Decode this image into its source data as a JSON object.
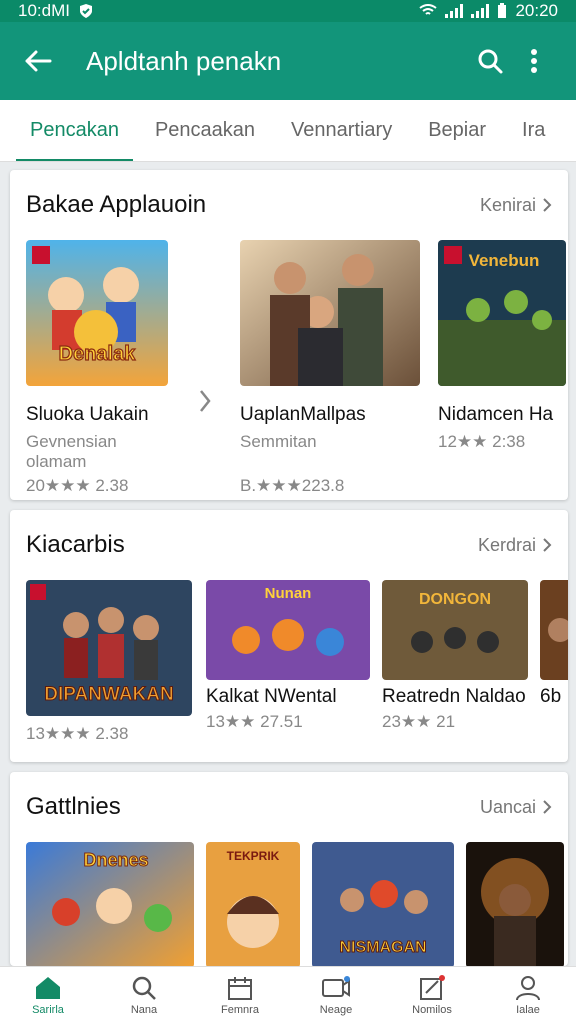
{
  "status": {
    "time": "10:dMI",
    "clock": "20:20"
  },
  "appbar": {
    "title": "Apldtanh penakn"
  },
  "tabs": [
    {
      "label": "Pencakan",
      "active": true
    },
    {
      "label": "Pencaakan"
    },
    {
      "label": "Vennartiary"
    },
    {
      "label": "Bepiar"
    },
    {
      "label": "Ira"
    }
  ],
  "section1": {
    "title": "Bakae Applauoin",
    "more": "Kenirai",
    "items": [
      {
        "name": "Sluoka Uakain",
        "sub": "Gevnensian\nolamam",
        "rating": "20★★★ 2.38",
        "thumb_text": "Denalak"
      },
      {
        "name": "UaplanMallpas",
        "sub": "Semmitan",
        "rating": "B.★★★223.8",
        "thumb_text": ""
      },
      {
        "name": "Nidamcen Ha",
        "sub": "",
        "rating": "12★★ 2:38",
        "thumb_text": "Venebun"
      }
    ]
  },
  "section2": {
    "title": "Kiacarbis",
    "more": "Kerdrai",
    "items": [
      {
        "name": "",
        "rating": "13★★★ 2.38",
        "thumb_text": "DIPANWAKAN"
      },
      {
        "name": "Kalkat NWental",
        "rating": "13★★ 27.51",
        "thumb_text": "Nunan"
      },
      {
        "name": "Reatredn Naldao",
        "rating": "23★★ 21",
        "thumb_text": "DONGON"
      },
      {
        "name": "6b",
        "rating": "",
        "thumb_text": ""
      }
    ]
  },
  "section3": {
    "title": "Gattlnies",
    "more": "Uancai",
    "items": [
      {
        "thumb_text": "Dnenes"
      },
      {
        "thumb_text": "TEKPRIK"
      },
      {
        "thumb_text": "NISMAGAN"
      },
      {
        "thumb_text": ""
      }
    ]
  },
  "bottom_nav": [
    {
      "label": "Sarirla",
      "icon": "home-icon",
      "active": true
    },
    {
      "label": "Nana",
      "icon": "search-icon"
    },
    {
      "label": "Femnra",
      "icon": "calendar-icon"
    },
    {
      "label": "Neage",
      "icon": "video-icon"
    },
    {
      "label": "Nomilos",
      "icon": "edit-icon"
    },
    {
      "label": "Ialae",
      "icon": "person-icon"
    }
  ],
  "colors": {
    "primary": "#12957a",
    "status": "#0b8a68",
    "accent": "#138a66"
  }
}
